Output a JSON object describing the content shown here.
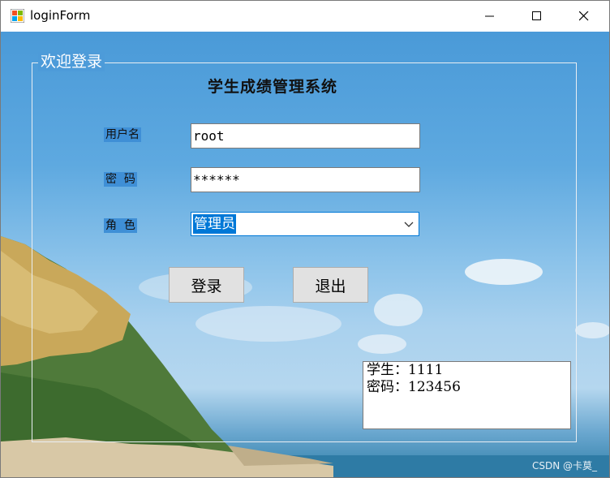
{
  "window": {
    "title": "loginForm"
  },
  "group": {
    "title": "欢迎登录"
  },
  "app_title": "学生成绩管理系统",
  "form": {
    "username_label": "用户名",
    "username_value": "root",
    "password_label": "密  码",
    "password_value": "******",
    "role_label": "角  色",
    "role_value": "管理员"
  },
  "buttons": {
    "login": "登录",
    "exit": "退出"
  },
  "hint": {
    "line1": "学生：1111",
    "line2": "密码：123456"
  },
  "watermark": "CSDN @卡莫_",
  "colors": {
    "accent": "#0078d7",
    "sky": "#4a9ad8"
  }
}
